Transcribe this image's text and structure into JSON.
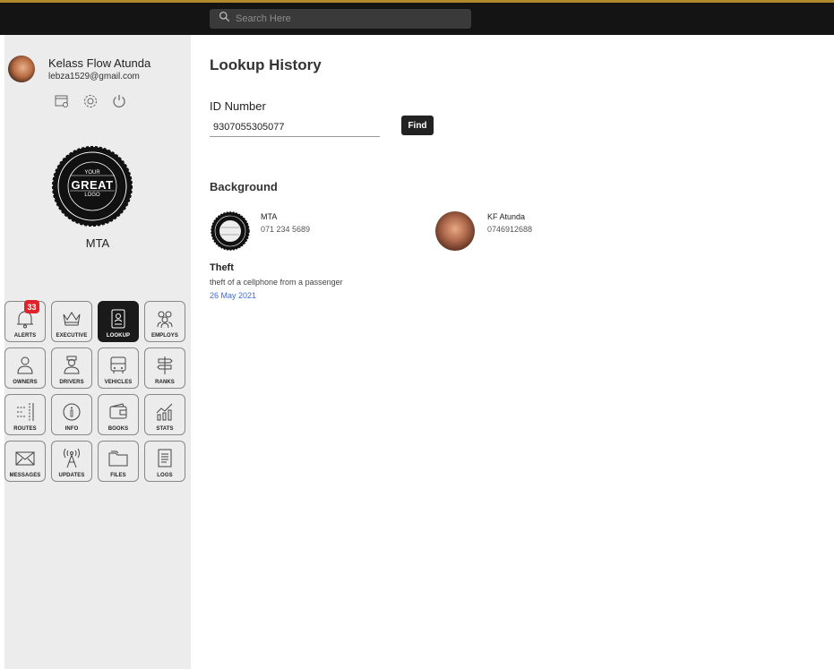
{
  "search": {
    "placeholder": "Search Here"
  },
  "profile": {
    "name": "Kelass Flow Atunda",
    "email": "lebza1529@gmail.com"
  },
  "brand": {
    "logo_text_top": "YOUR",
    "logo_text_mid": "GREAT",
    "logo_text_bot": "LOGO",
    "org_name": "MTA"
  },
  "tiles": [
    {
      "label": "ALERTS",
      "icon": "bell-icon",
      "badge": "33"
    },
    {
      "label": "EXECUTIVE",
      "icon": "crown-icon"
    },
    {
      "label": "LOOKUP",
      "icon": "id-card-icon",
      "active": true
    },
    {
      "label": "EMPLOYS",
      "icon": "group-icon"
    },
    {
      "label": "OWNERS",
      "icon": "owner-icon"
    },
    {
      "label": "DRIVERS",
      "icon": "driver-icon"
    },
    {
      "label": "VEHICLES",
      "icon": "bus-icon"
    },
    {
      "label": "RANKS",
      "icon": "signpost-icon"
    },
    {
      "label": "ROUTES",
      "icon": "routes-icon"
    },
    {
      "label": "INFO",
      "icon": "info-icon"
    },
    {
      "label": "BOOKS",
      "icon": "wallet-icon"
    },
    {
      "label": "STATS",
      "icon": "stats-icon"
    },
    {
      "label": "MESSAGES",
      "icon": "envelope-icon"
    },
    {
      "label": "UPDATES",
      "icon": "antenna-icon"
    },
    {
      "label": "FILES",
      "icon": "folder-icon"
    },
    {
      "label": "LOGS",
      "icon": "document-icon"
    }
  ],
  "main": {
    "title": "Lookup History",
    "id_label": "ID Number",
    "id_value": "9307055305077",
    "find_label": "Find",
    "background_title": "Background",
    "contacts": [
      {
        "name": "MTA",
        "phone": "071 234 5689"
      },
      {
        "name": "KF Atunda",
        "phone": "0746912688"
      }
    ],
    "incident": {
      "title": "Theft",
      "description": "theft of a cellphone from a passenger",
      "date": "26 May 2021"
    }
  },
  "colors": {
    "accent_gold": "#b08a2a",
    "topbar": "#141414",
    "sidebar": "#ececec",
    "badge": "#e0222a",
    "link_blue": "#3a6bd8"
  }
}
